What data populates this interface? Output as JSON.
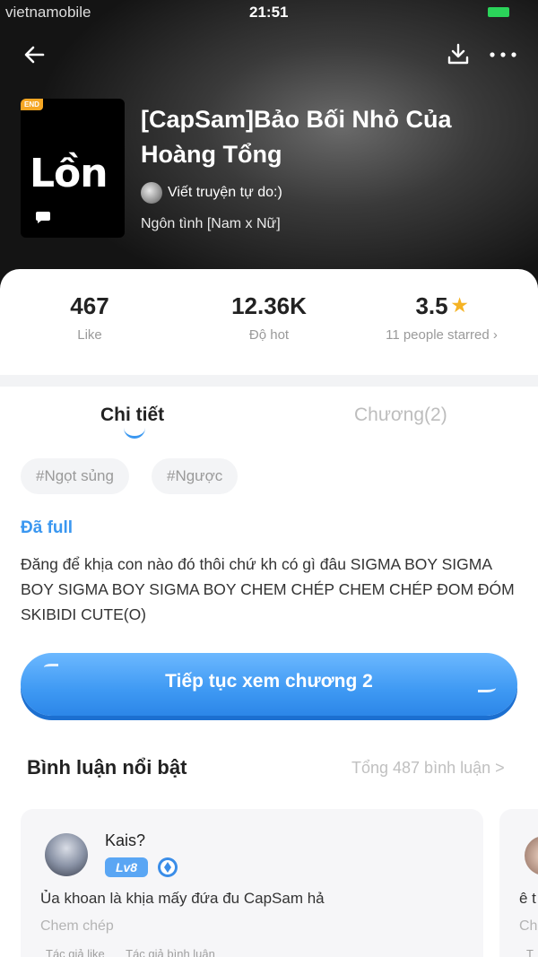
{
  "status_bar": {
    "carrier": "vietnamobile",
    "time": "21:51"
  },
  "header": {
    "cover_badge": "END",
    "cover_word": "Lồn",
    "title": "[CapSam]Bảo Bối Nhỏ Của Hoàng Tổng",
    "author": "Viết truyện tự do:)",
    "genre": "Ngôn tình [Nam x Nữ]"
  },
  "stats": {
    "like_value": "467",
    "like_label": "Like",
    "hot_value": "12.36K",
    "hot_label": "Độ hot",
    "rating_value": "3.5",
    "rating_label": "11 people starred ›"
  },
  "tabs": {
    "active": "Chi tiết",
    "inactive": "Chương(2)"
  },
  "tags": [
    "#Ngọt sủng",
    "#Ngược"
  ],
  "detail": {
    "status": "Đã full",
    "description": "Đăng để khịa con nào đó thôi chứ kh có gì đâu SIGMA BOY SIGMA BOY SIGMA BOY SIGMA BOY CHEM CHÉP CHEM CHÉP ĐOM ĐÓM SKIBIDI CUTE(O)",
    "continue_button": "Tiếp tục xem chương 2"
  },
  "comments": {
    "title": "Bình luận nổi bật",
    "total": "Tổng 487 bình luận >",
    "items": [
      {
        "user": "Kais?",
        "level": "Lv8",
        "text": "Ủa khoan là khịa mấy đứa đu CapSam hả",
        "sub": "Chem chép",
        "meta_like": "Tác giả like",
        "meta_comment": "Tác giả bình luận"
      },
      {
        "text": "ê t",
        "sub": "Ch",
        "meta": "T"
      }
    ]
  },
  "colors": {
    "accent": "#3a97f0",
    "star": "#f5b324",
    "level_badge": "#5aa6f4"
  }
}
